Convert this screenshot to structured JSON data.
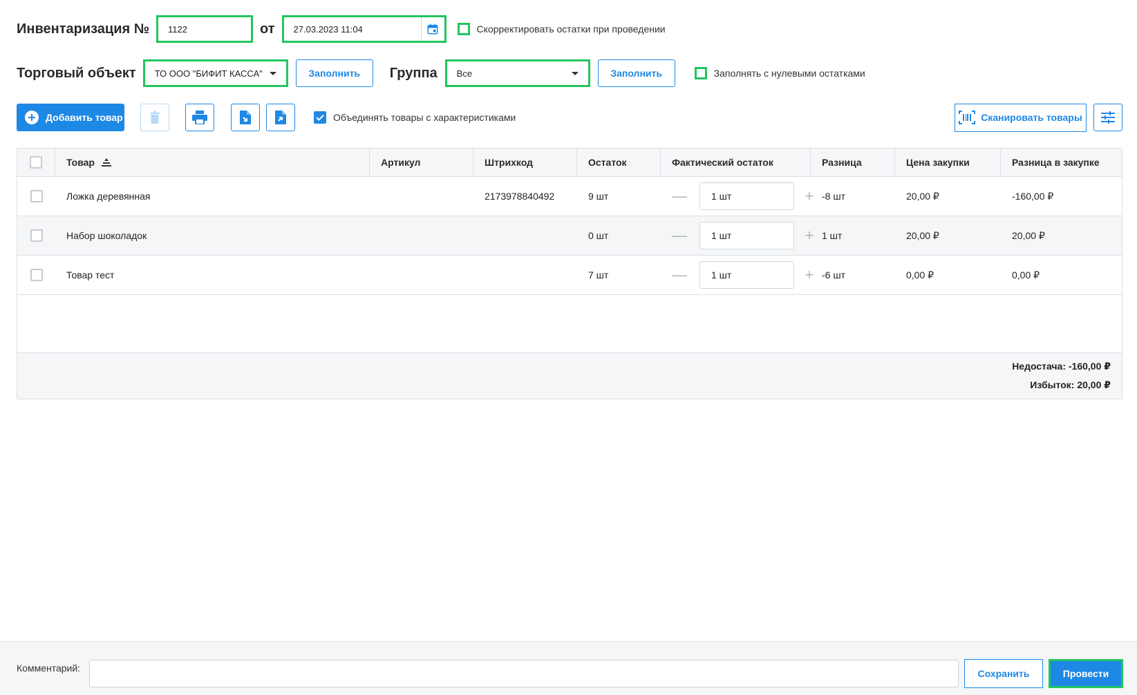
{
  "header": {
    "inventory_label": "Инвентаризация №",
    "inventory_number": "1122",
    "from_label": "от",
    "date_value": "27.03.2023 11:04",
    "adjust_label": "Скорректировать остатки при проведении"
  },
  "filters": {
    "store_label": "Торговый объект",
    "store_value": "ТО ООО \"БИФИТ КАССА\"",
    "fill_label": "Заполнить",
    "group_label": "Группа",
    "group_value": "Все",
    "fill2_label": "Заполнить",
    "zero_label": "Заполнять с нулевыми остатками"
  },
  "toolbar": {
    "add_label": "Добавить товар",
    "merge_label": "Объединять товары с характеристиками",
    "scan_label": "Сканировать товары"
  },
  "table": {
    "columns": [
      "Товар",
      "Артикул",
      "Штрихкод",
      "Остаток",
      "Фактический остаток",
      "Разница",
      "Цена закупки",
      "Разница в закупке"
    ],
    "rows": [
      {
        "name": "Ложка деревянная",
        "article": "",
        "barcode": "2173978840492",
        "rest": "9 шт",
        "fact": "1 шт",
        "diff": "-8 шт",
        "price": "20,00 ₽",
        "pdiff": "-160,00 ₽"
      },
      {
        "name": "Набор шоколадок",
        "article": "",
        "barcode": "",
        "rest": "0 шт",
        "fact": "1 шт",
        "diff": "1 шт",
        "price": "20,00 ₽",
        "pdiff": "20,00 ₽"
      },
      {
        "name": "Товар тест",
        "article": "",
        "barcode": "",
        "rest": "7 шт",
        "fact": "1 шт",
        "diff": "-6 шт",
        "price": "0,00 ₽",
        "pdiff": "0,00 ₽"
      }
    ],
    "shortage": "Недостача: -160,00 ₽",
    "surplus": "Избыток: 20,00 ₽"
  },
  "footer": {
    "comment_label": "Комментарий:",
    "comment_value": "",
    "save_label": "Сохранить",
    "post_label": "Провести"
  },
  "colors": {
    "accent": "#1e88e5",
    "highlight": "#22c55e"
  }
}
